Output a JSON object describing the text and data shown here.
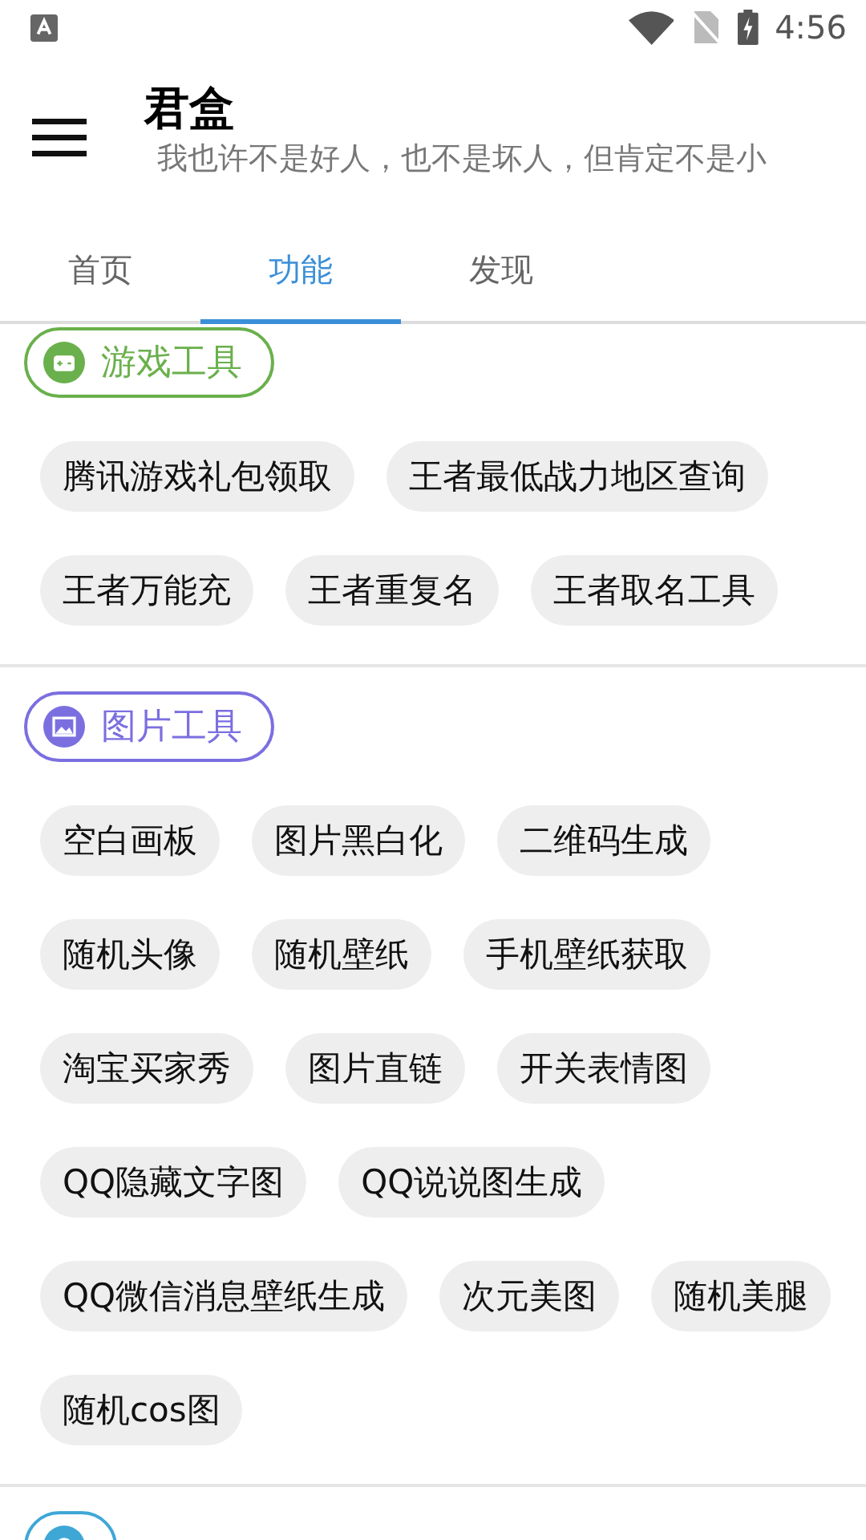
{
  "status_bar": {
    "time": "4:56"
  },
  "app_bar": {
    "title": "君盒",
    "subtitle": "我也许不是好人，也不是坏人，但肯定不是小"
  },
  "tabs": [
    {
      "label": "首页",
      "selected": false
    },
    {
      "label": "功能",
      "selected": true
    },
    {
      "label": "发现",
      "selected": false
    }
  ],
  "sections": [
    {
      "title": "游戏工具",
      "kind": "game",
      "color": "#6ab04c",
      "items": [
        "腾讯游戏礼包领取",
        "王者最低战力地区查询",
        "王者万能充",
        "王者重复名",
        "王者取名工具"
      ]
    },
    {
      "title": "图片工具",
      "kind": "image",
      "color": "#7b6fe0",
      "items": [
        "空白画板",
        "图片黑白化",
        "二维码生成",
        "随机头像",
        "随机壁纸",
        "手机壁纸获取",
        "淘宝买家秀",
        "图片直链",
        "开关表情图",
        "QQ隐藏文字图",
        "QQ说说图生成",
        "QQ微信消息壁纸生成",
        "次元美图",
        "随机美腿",
        "随机cos图"
      ]
    },
    {
      "kind": "other",
      "color": "#3fa7d6"
    }
  ]
}
